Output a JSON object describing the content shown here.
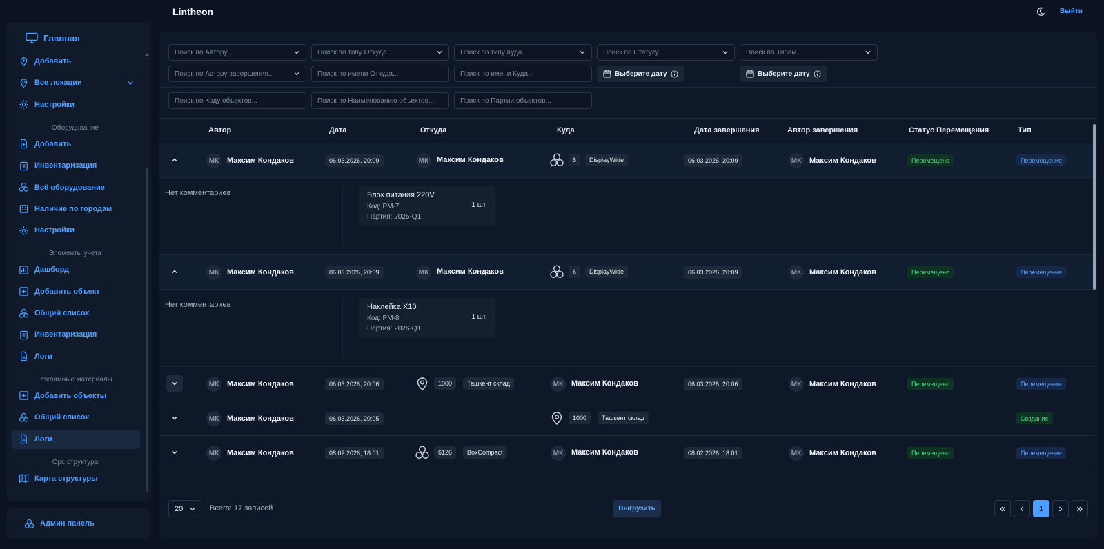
{
  "app": {
    "title": "Lintheon",
    "logout_label": "Выйти"
  },
  "sidebar": {
    "home_label": "Главная",
    "groups": [
      {
        "items": [
          {
            "label": "Добавить",
            "icon": "map-pin-plus-icon"
          },
          {
            "label": "Все локации",
            "icon": "map-pin-icon",
            "has_chevron": true
          },
          {
            "label": "Настройки",
            "icon": "gear-icon"
          }
        ]
      },
      {
        "section": "Оборудование",
        "items": [
          {
            "label": "Добавить",
            "icon": "file-plus-icon"
          },
          {
            "label": "Инвентаризация",
            "icon": "clipboard-icon"
          },
          {
            "label": "Всё оборудование",
            "icon": "boxes-icon"
          },
          {
            "label": "Наличие по городам",
            "icon": "building-icon"
          },
          {
            "label": "Настройки",
            "icon": "gear-icon"
          }
        ]
      },
      {
        "section": "Элементы учета",
        "items": [
          {
            "label": "Дашборд",
            "icon": "dashboard-icon"
          },
          {
            "label": "Добавить объект",
            "icon": "plus-square-icon"
          },
          {
            "label": "Общий список",
            "icon": "boxes-icon"
          },
          {
            "label": "Инвентаризация",
            "icon": "clipboard-icon"
          },
          {
            "label": "Логи",
            "icon": "chart-file-icon"
          }
        ]
      },
      {
        "section": "Рекламные материалы",
        "items": [
          {
            "label": "Добавить объекты",
            "icon": "plus-square-icon"
          },
          {
            "label": "Общий список",
            "icon": "boxes-icon"
          },
          {
            "label": "Логи",
            "icon": "chart-file-icon",
            "active": true
          }
        ]
      },
      {
        "section": "Орг. структура",
        "items": [
          {
            "label": "Карта структуры",
            "icon": "map-icon"
          }
        ]
      }
    ],
    "admin_label": "Админ панель"
  },
  "filters": {
    "author": "Поиск по Автору...",
    "from_type": "Поиск по типу Откуда...",
    "to_type": "Поиск по типу Куда...",
    "status": "Поиск по Статусу...",
    "types": "Поиск по Типам...",
    "completion_author": "Поиск по Автору завершения...",
    "from_name": "Поиск по имени Откуда...",
    "to_name": "Поиск по имени Куда...",
    "date_label": "Выберите дату",
    "object_code": "Поиск по Коду объектов...",
    "object_name": "Поиск по Наименованию объектов...",
    "object_batch": "Поиск по Партии объектов..."
  },
  "table": {
    "headers": {
      "author": "Автор",
      "date": "Дата",
      "from": "Откуда",
      "to": "Куда",
      "completed_date": "Дата завершения",
      "completed_author": "Автор завершения",
      "status": "Статус Перемещения",
      "type": "Тип"
    },
    "rows": [
      {
        "expanded": true,
        "initials": "МК",
        "author": "Максим Кондаков",
        "date": "06.03.2026, 20:09",
        "from": {
          "kind": "user",
          "initials": "МК",
          "name": "Максим Кондаков"
        },
        "to": {
          "kind": "boxes",
          "icon": "boxes-icon",
          "code": "6",
          "name": "DisplayWide"
        },
        "completed_date": "06.03.2026, 20:09",
        "completed_initials": "МК",
        "completed_author": "Максим Кондаков",
        "status": "Перемещено",
        "type": "Перемещение",
        "comment": "Нет комментариев",
        "item": {
          "title": "Блок питания 220V",
          "code": "Код: PM-7",
          "qty": "1 шт.",
          "batch": "Партия: 2025-Q1"
        }
      },
      {
        "expanded": true,
        "initials": "МК",
        "author": "Максим Кондаков",
        "date": "06.03.2026, 20:09",
        "from": {
          "kind": "user",
          "initials": "МК",
          "name": "Максим Кондаков"
        },
        "to": {
          "kind": "boxes",
          "icon": "boxes-icon",
          "code": "6",
          "name": "DisplayWide"
        },
        "completed_date": "06.03.2026, 20:09",
        "completed_initials": "МК",
        "completed_author": "Максим Кондаков",
        "status": "Перемещено",
        "type": "Перемещение",
        "comment": "Нет комментариев",
        "item": {
          "title": "Наклейка X10",
          "code": "Код: PM-8",
          "qty": "1 шт.",
          "batch": "Партия: 2026-Q1"
        }
      },
      {
        "expanded": false,
        "initials": "МК",
        "author": "Максим Кондаков",
        "date": "06.03.2026, 20:06",
        "from": {
          "kind": "location",
          "icon": "map-pin-icon",
          "code": "1000",
          "name": "Ташкент склад"
        },
        "to": {
          "kind": "user",
          "initials": "МК",
          "name": "Максим Кондаков"
        },
        "completed_date": "06.03.2026, 20:06",
        "completed_initials": "МК",
        "completed_author": "Максим Кондаков",
        "status": "Перемещено",
        "type": "Перемещение"
      },
      {
        "expanded": false,
        "initials": "МК",
        "author": "Максим Кондаков",
        "date": "06.03.2026, 20:05",
        "from": null,
        "to": {
          "kind": "location",
          "icon": "map-pin-icon",
          "code": "1000",
          "name": "Ташкент склад"
        },
        "completed_date": "",
        "completed_initials": "",
        "completed_author": "",
        "status": "",
        "type": "Создание"
      },
      {
        "expanded": false,
        "initials": "МК",
        "author": "Максим Кондаков",
        "date": "08.02.2026, 18:01",
        "from": {
          "kind": "boxes",
          "icon": "boxes-icon",
          "code": "6126",
          "name": "BoxCompact"
        },
        "to": {
          "kind": "user",
          "initials": "МК",
          "name": "Максим Кондаков"
        },
        "completed_date": "08.02.2026, 18:01",
        "completed_initials": "МК",
        "completed_author": "Максим Кондаков",
        "status": "Перемещено",
        "type": "Перемещение"
      }
    ]
  },
  "footer": {
    "page_size": "20",
    "total": "Всего: 17 записей",
    "export_label": "Выгрузить",
    "current_page": "1"
  },
  "colors": {
    "accent": "#4f9dff",
    "status_green": "#3ddc84",
    "background": "#0b1322",
    "panel": "#0f1829"
  }
}
